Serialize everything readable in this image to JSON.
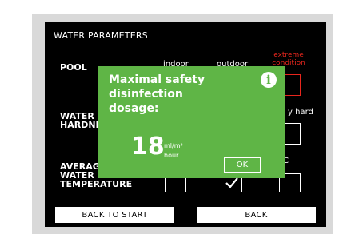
{
  "screen": {
    "title": "WATER PARAMETERS",
    "rows": {
      "pool": "POOL",
      "water_hardness": [
        "WATER",
        "HARDNESS"
      ],
      "average_temperature": [
        "AVERAGE",
        "WATER",
        "TEMPERATURE"
      ]
    },
    "pool_columns": {
      "indoor": "indoor",
      "outdoor": "outdoor",
      "extreme": [
        "extreme",
        "condition"
      ]
    },
    "hardness_column_visible": "y hard",
    "temperature_column_visible": "°C",
    "temperature_check_selected": "middle",
    "buttons": {
      "back_to_start": "BACK TO START",
      "back": "BACK"
    }
  },
  "dialog": {
    "lines": [
      "Maximal safety",
      "disinfection",
      "dosage:"
    ],
    "value": "18",
    "unit_top": "ml/m³",
    "unit_bottom": "hour",
    "ok_label": "OK",
    "info_icon": "info-icon",
    "color": "#5fb546"
  },
  "colors": {
    "extreme": "#e8261d"
  }
}
